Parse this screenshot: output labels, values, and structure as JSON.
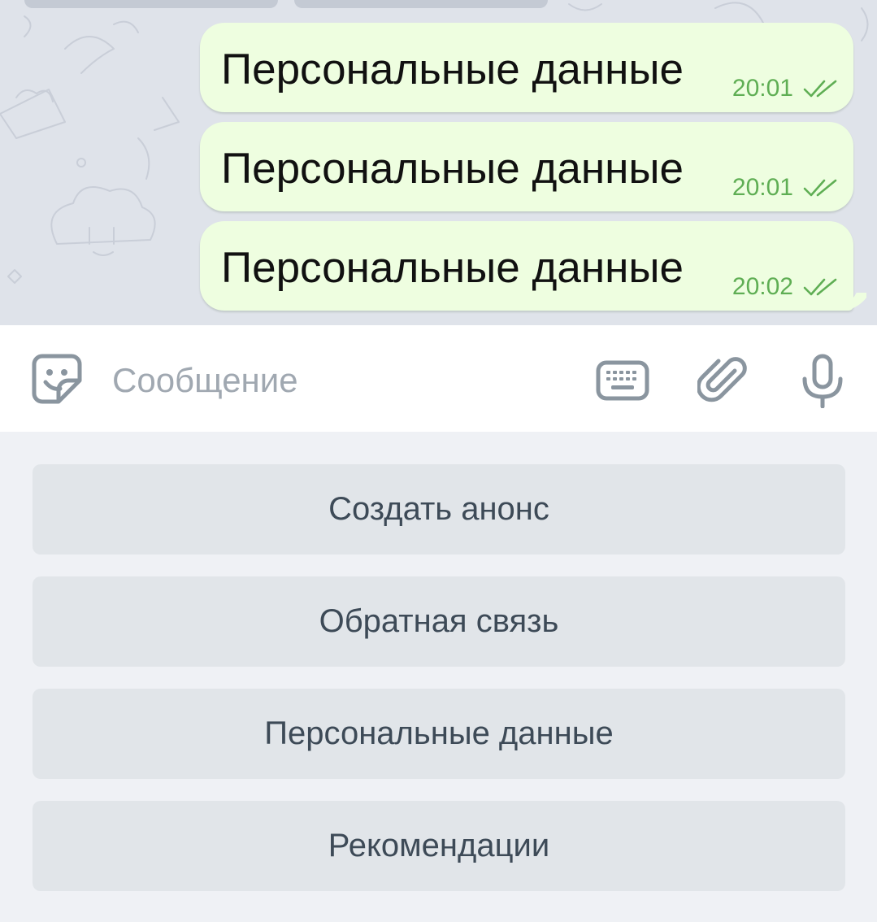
{
  "messages": [
    {
      "text": "Персональные данные",
      "time": "20:01",
      "status_icon": "double-check-icon"
    },
    {
      "text": "Персональные данные",
      "time": "20:01",
      "status_icon": "double-check-icon"
    },
    {
      "text": "Персональные данные",
      "time": "20:02",
      "status_icon": "double-check-icon"
    }
  ],
  "composer": {
    "placeholder": "Сообщение",
    "value": "",
    "icons": [
      "sticker-icon",
      "keyboard-icon",
      "paperclip-icon",
      "microphone-icon"
    ]
  },
  "bot_keyboard": {
    "buttons": [
      {
        "label": "Создать анонс"
      },
      {
        "label": "Обратная связь"
      },
      {
        "label": "Персональные данные"
      },
      {
        "label": "Рекомендации"
      }
    ]
  },
  "colors": {
    "bubble_bg": "#eefee0",
    "time_and_checks": "#5fae54",
    "chat_background": "#dfe3ea",
    "keyboard_button_bg": "#e1e5e9",
    "keyboard_text": "#3d4a57",
    "icon_gray": "#8a959f"
  }
}
